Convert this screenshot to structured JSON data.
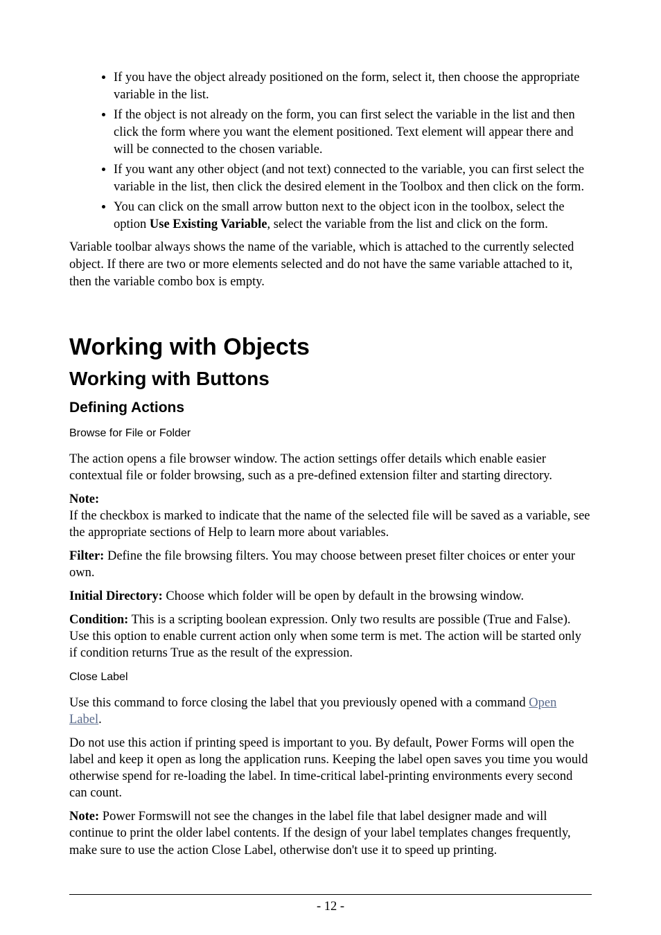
{
  "bullets": [
    "If you have the object already positioned on the form, select it, then choose the appropriate variable in the list.",
    "If the object is not already on the form, you can first select the variable in the list and then click the form where you want the element positioned. Text element will appear there and will be connected to the chosen variable.",
    "If you want any other object (and not text) connected to the variable, you can first select the variable in the list, then click the desired element in the Toolbox and then click on the form."
  ],
  "bullet4_pre": "You can click on the small arrow button next to the object icon in the toolbox, select the option ",
  "bullet4_bold": "Use Existing Variable",
  "bullet4_post": ", select the variable from the list and click on the form.",
  "intro_para": "Variable toolbar always shows the name of the variable, which is attached to the currently selected object. If there are two or more elements selected and do not have the same variable attached to it, then the variable combo box is empty.",
  "h1": "Working with Objects",
  "h2": "Working with Buttons",
  "h3": "Defining Actions",
  "sub1": "Browse for File or Folder",
  "p_browse": "The action opens a file browser window. The action settings offer details which enable easier contextual file or folder browsing, such as a pre-defined extension filter and starting directory.",
  "note1_label": "Note:",
  "note1_body": "If the checkbox is marked to indicate that the name of the selected file will be saved as a variable, see the appropriate sections of Help to learn more about variables.",
  "filter_label": "Filter:",
  "filter_body": " Define the file browsing filters. You may choose between preset filter choices or enter your own.",
  "init_label": "Initial Directory:",
  "init_body": " Choose which folder will be open by default in the browsing window.",
  "cond_label": "Condition:",
  "cond_body": " This is a scripting boolean expression. Only two results are possible (True and False). Use this option to enable current action only when some term is met. The action will be started only if condition returns True as the result of the expression.",
  "sub2": "Close Label",
  "close_pre": "Use this command to force closing the label that you previously opened with a command ",
  "close_link": "Open Label",
  "close_post": ".",
  "close_p2": "Do not use this action if printing speed is important to you. By default, Power Forms will open the label and keep it open as long the application runs. Keeping the label open saves you time you would otherwise spend for re-loading the label. In time-critical label-printing environments every second can count.",
  "note2_label": "Note:",
  "note2_body": " Power Formswill not see the changes in the label file that label designer made and will continue to print the older label contents. If the design of your label templates changes frequently, make sure to use the action Close Label, otherwise don't use it to speed up printing.",
  "page_number": "- 12 -"
}
